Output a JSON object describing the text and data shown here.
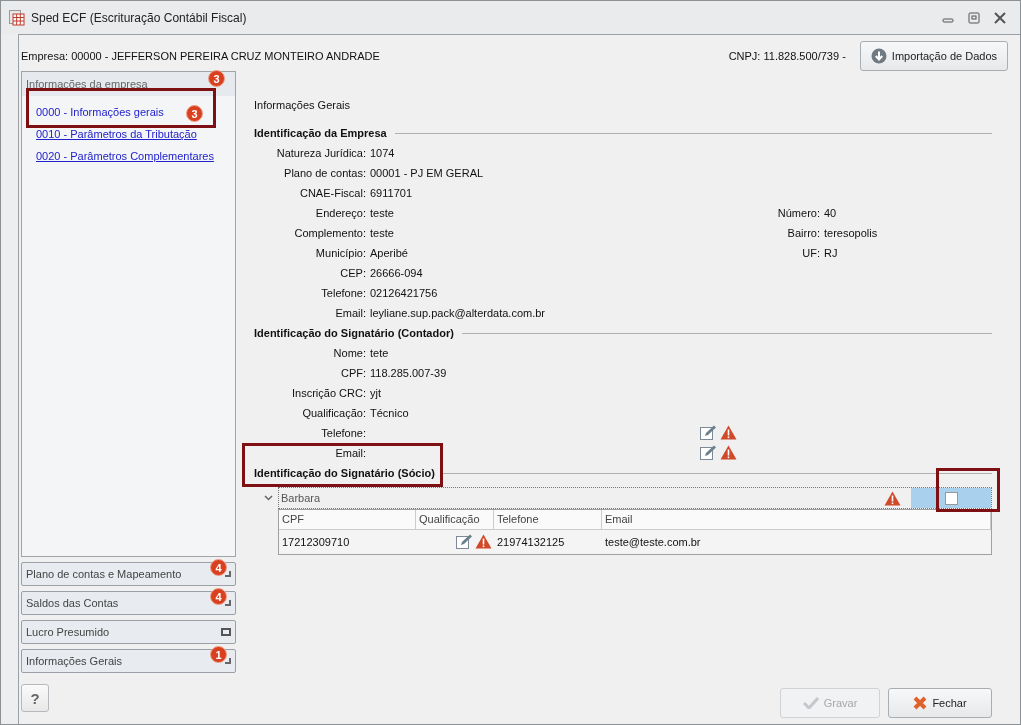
{
  "window": {
    "title": "Sped ECF (Escrituração Contábil Fiscal)"
  },
  "header": {
    "company": "Empresa: 00000 - JEFFERSON PEREIRA CRUZ MONTEIRO ANDRADE",
    "cnpj": "CNPJ: 11.828.500/739 -",
    "import_button": "Importação de Dados"
  },
  "sidebar": {
    "panel": {
      "title": "Informações da empresa",
      "badge": "3",
      "items": [
        {
          "label": "0000 - Informações gerais",
          "badge": "3",
          "selected": true,
          "highlighted": true
        },
        {
          "label": "0010 - Parâmetros da Tributação",
          "selected": false,
          "highlighted": false
        },
        {
          "label": "0020 - Parâmetros Complementares",
          "selected": false,
          "highlighted": false
        }
      ]
    },
    "groups": [
      {
        "label": "Plano de contas e Mapeamento",
        "badge": "4",
        "kind": "corner"
      },
      {
        "label": "Saldos das Contas",
        "badge": "4",
        "kind": "corner"
      },
      {
        "label": "Lucro Presumido",
        "kind": "square"
      },
      {
        "label": "Informações Gerais",
        "badge": "1",
        "kind": "corner"
      }
    ]
  },
  "content": {
    "heading": "Informações Gerais",
    "sections": [
      {
        "title": "Identificação da Empresa",
        "highlighted": false,
        "rows": [
          {
            "label": "Natureza Jurídica:",
            "value": "1074"
          },
          {
            "label": "Plano de contas:",
            "value": "00001 - PJ EM GERAL"
          },
          {
            "label": "CNAE-Fiscal:",
            "value": "6911701"
          },
          {
            "label": "Endereço:",
            "value": "teste",
            "right": {
              "label": "Número:",
              "value": "40"
            }
          },
          {
            "label": "Complemento:",
            "value": "teste",
            "right": {
              "label": "Bairro:",
              "value": "teresopolis"
            }
          },
          {
            "label": "Município:",
            "value": "Aperibé",
            "right": {
              "label": "UF:",
              "value": "RJ"
            }
          },
          {
            "label": "CEP:",
            "value": "26666-094"
          },
          {
            "label": "Telefone:",
            "value": "02126421756"
          },
          {
            "label": "Email:",
            "value": "leyliane.sup.pack@alterdata.com.br"
          }
        ]
      },
      {
        "title": "Identificação do Signatário (Contador)",
        "highlighted": false,
        "rows": [
          {
            "label": "Nome:",
            "value": "tete"
          },
          {
            "label": "CPF:",
            "value": "118.285.007-39"
          },
          {
            "label": "Inscrição CRC:",
            "value": "yjt"
          },
          {
            "label": "Qualificação:",
            "value": "Técnico"
          },
          {
            "label": "Telefone:",
            "warning": true
          },
          {
            "label": "Email:",
            "warning": true
          }
        ]
      },
      {
        "title": "Identificação do Signatário (Sócio)",
        "highlighted": true,
        "grid": {
          "group": {
            "label": "Barbara",
            "expanded": true,
            "warning": true,
            "checked": false,
            "highlighted": true
          },
          "columns": [
            "CPF",
            "Qualificação",
            "Telefone",
            "Email"
          ],
          "rows": [
            {
              "cpf": "17212309710",
              "qualificacao_warning": true,
              "telefone": "21974132125",
              "email": "teste@teste.com.br"
            }
          ]
        }
      }
    ]
  },
  "help_button": "?",
  "buttons": [
    {
      "label": "Gravar",
      "kind": "save",
      "disabled": true
    },
    {
      "label": "Fechar",
      "kind": "close",
      "disabled": false
    }
  ]
}
